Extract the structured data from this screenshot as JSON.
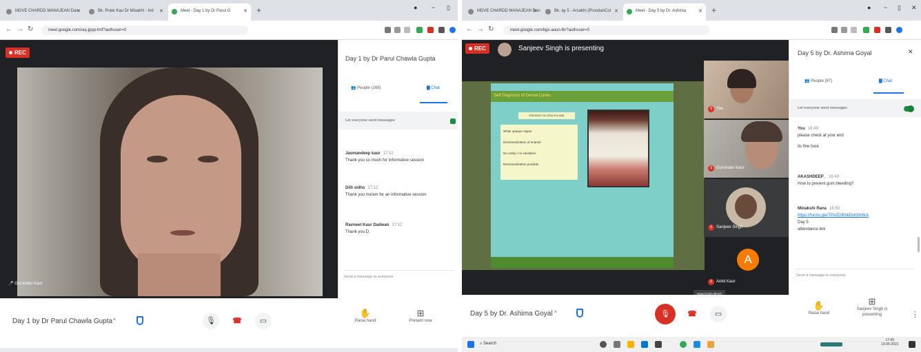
{
  "left": {
    "tabs": [
      {
        "label": "MDVE CHARDD MANAJEAN Dan"
      },
      {
        "label": "Bk. Prate Kau Dr Misakhi - Ind"
      },
      {
        "label": "Meet - Day 1 by Dr Parul G"
      }
    ],
    "url": "meet.google.com/uuj-jppp-hnf?authuser=0",
    "rec": "REC",
    "panel": {
      "title": "Day 1 by Dr Parul Chawla Gupta",
      "people_tab": "People (169)",
      "chat_tab": "Chat",
      "let_msgs": "Let everyone send messages",
      "messages": [
        {
          "name": "Jasmandeep kaur",
          "time": "17:12",
          "text": "Thank you so much for informative session"
        },
        {
          "name": "Dilli sidhs",
          "time": "17:12",
          "text": "Thank you ma'am for an informative session"
        },
        {
          "name": "Ravneet Kaur Dadwan",
          "time": "17:12",
          "text": "Thank you D."
        }
      ],
      "input": "Send a message to everyone"
    },
    "speaker": "Gurvinder Kaur",
    "meeting_title": "Day 1 by Dr Parul Chawla Gupta",
    "raise_hand": "Raise hand",
    "present_now": "Present now"
  },
  "right": {
    "tabs": [
      {
        "label": "MDVE CHARDD MANAJEAN Dan"
      },
      {
        "label": "Bk. ay 5 - Arsakhi (ProndanCol"
      },
      {
        "label": "Meet - Day 5 by Dr. Ashima"
      }
    ],
    "url": "meet.google.com/bgx-aoun-fkr?authuser=0",
    "rec": "REC",
    "presenting": "Sanjeev Singh is presenting",
    "slide": {
      "title": "Self Diagnosis of Dental Caries",
      "header": "PRESENT IN CRACKS AND",
      "items": [
        "White opaque region",
        "Demineralization of enamel",
        "No cavity / no cavitation",
        "Remineralization possible"
      ]
    },
    "tiles": [
      {
        "name": "You"
      },
      {
        "name": "Gurvinder Kaur"
      },
      {
        "name": "Sanjeev Singh"
      },
      {
        "name": "Ankit Kaur"
      }
    ],
    "avatar_letter": "A",
    "tooltip": "Hand (Ctrl+Alt+H)",
    "panel": {
      "title": "Day 5 by Dr. Ashima Goyal",
      "people_tab": "People (87)",
      "chat_tab": "Chat",
      "let_msgs": "Let everyone send messages",
      "messages": [
        {
          "name": "You",
          "time": "16:49",
          "lines": [
            "please check at your end",
            "its fine here"
          ]
        },
        {
          "name": "AKASHDEEP_",
          "time": "16:49",
          "lines": [
            "How to prevent gum bleeding?"
          ]
        },
        {
          "name": "Minakshi Rana",
          "time": "16:50",
          "link": "https://forms.gle/TPeZDBNkDvKNh6rA",
          "lines": [
            "Day 5",
            "attendance link"
          ]
        }
      ],
      "input": "Send a message to everyone"
    },
    "meeting_title": "Day 5 by Dr. Ashima Goyal",
    "raise_hand": "Raise hand",
    "presenting_label": "Sanjeev Singh is presenting",
    "search": "Search",
    "clock": "17:00",
    "date": "13-05-2021"
  }
}
